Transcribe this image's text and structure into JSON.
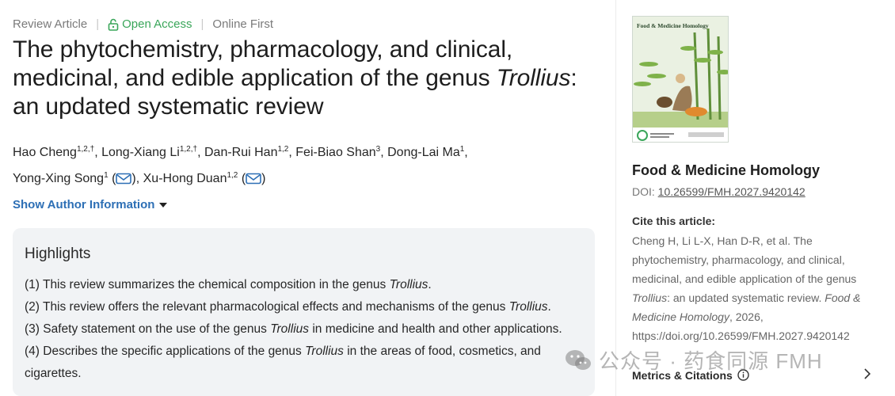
{
  "article": {
    "type": "Review Article",
    "access": "Open Access",
    "status": "Online First",
    "title_part1": "The phytochemistry, pharmacology, and clinical, medicinal, and edible application of the genus ",
    "title_genus": "Trollius",
    "title_part2": ": an updated systematic review",
    "authors": [
      {
        "name": "Hao Cheng",
        "sup": "1,2,†"
      },
      {
        "name": "Long-Xiang Li",
        "sup": "1,2,†"
      },
      {
        "name": "Dan-Rui Han",
        "sup": "1,2"
      },
      {
        "name": "Fei-Biao Shan",
        "sup": "3"
      },
      {
        "name": "Dong-Lai Ma",
        "sup": "1"
      },
      {
        "name": "Yong-Xing Song",
        "sup": "1"
      },
      {
        "name": "Xu-Hong Duan",
        "sup": "1,2"
      }
    ],
    "show_author_info": "Show Author Information"
  },
  "highlights": {
    "title": "Highlights",
    "items": [
      {
        "before": "(1) This review summarizes the chemical composition in the genus ",
        "genus": "Trollius",
        "after": "."
      },
      {
        "before": "(2) This review offers the relevant pharmacological effects and mechanisms of the genus ",
        "genus": "Trollius",
        "after": "."
      },
      {
        "before": "(3) Safety statement on the use of the genus ",
        "genus": "Trollius",
        "after": " in medicine and health and other applications."
      },
      {
        "before": "(4) Describes the specific applications of the genus ",
        "genus": "Trollius",
        "after": " in the areas of food, cosmetics, and cigarettes."
      }
    ]
  },
  "sidebar": {
    "cover_title": "Food & Medicine Homology",
    "journal": "Food & Medicine Homology",
    "doi_label": "DOI: ",
    "doi": "10.26599/FMH.2027.9420142",
    "cite_heading": "Cite this article:",
    "cite_part1": "Cheng H, Li L-X, Han D-R, et al. The phytochemistry, pharmacology, and clinical, medicinal, and edible application of the genus ",
    "cite_genus": "Trollius",
    "cite_part2": ": an updated systematic review. ",
    "cite_journal": "Food & Medicine Homology",
    "cite_part3": ", 2026, https://doi.org/10.26599/FMH.2027.9420142",
    "metrics": "Metrics & Citations"
  },
  "watermark": "公众号 · 药食同源 FMH",
  "colors": {
    "link": "#2d6fb5",
    "open_access": "#3aa65a",
    "highlight_bg": "#f1f3f5"
  }
}
